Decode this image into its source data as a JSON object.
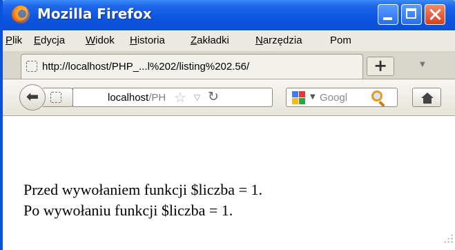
{
  "window": {
    "title": "Mozilla Firefox"
  },
  "menu": {
    "items": [
      {
        "accel": "P",
        "rest": "lik"
      },
      {
        "accel": "E",
        "rest": "dycja"
      },
      {
        "accel": "W",
        "rest": "idok"
      },
      {
        "accel": "H",
        "rest": "istoria"
      },
      {
        "accel": "Z",
        "rest": "akładki"
      },
      {
        "accel": "N",
        "rest": "arzędzia"
      },
      {
        "accel": "",
        "rest": "Pom"
      }
    ]
  },
  "tabs": [
    {
      "title": "http://localhost/PHP_...l%202/listing%202.56/"
    }
  ],
  "newtab_label": "+",
  "navbar": {
    "url_host": "localhost",
    "url_path": "/PH",
    "search_placeholder": "Googl"
  },
  "page": {
    "lines": [
      "Przed wywołaniem funkcji $liczba = 1.",
      "Po wywołaniu funkcji $liczba = 1."
    ]
  },
  "colors": {
    "titlebar": "#0b55e0",
    "chrome": "#ebe9e1"
  }
}
